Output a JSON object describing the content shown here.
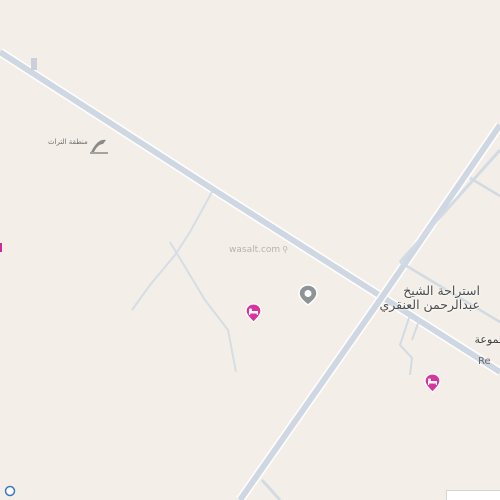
{
  "map": {
    "watermark_text": "wasalt.com",
    "poi": {
      "name_line1": "استراحة الشيخ",
      "name_line2": "عبدالرحمن العنقري",
      "icon": "location-pin-icon"
    },
    "edge_label_arabic": "مجموعة",
    "edge_label_latin": "Re",
    "logo_text": "منطقة التراث",
    "markers": [
      {
        "icon": "hotel-bed-icon",
        "color": "#d6359e"
      },
      {
        "icon": "hotel-bed-icon",
        "color": "#d6359e"
      }
    ],
    "colors": {
      "land": "#f3efe8",
      "road": "#ccd5df",
      "marker": "#d6359e"
    }
  }
}
